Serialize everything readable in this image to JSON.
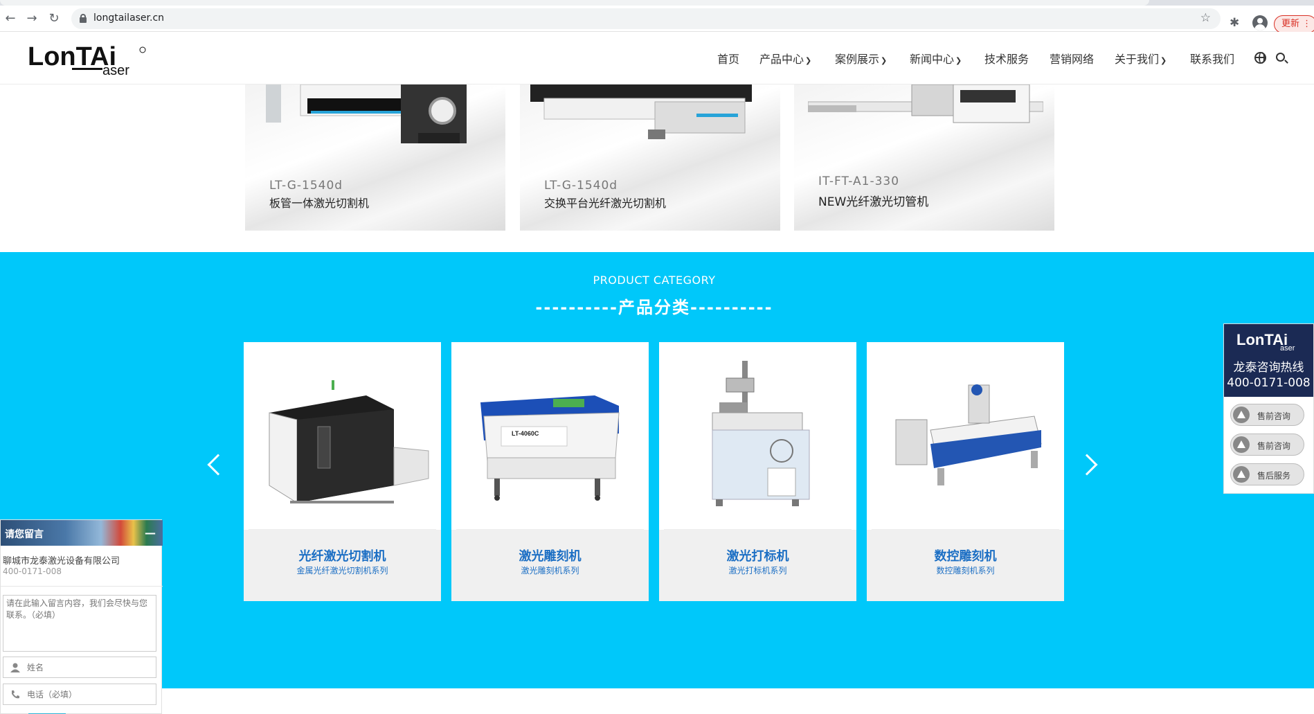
{
  "browser": {
    "url": "longtailaser.cn",
    "update_label": "更新"
  },
  "header": {
    "logo_text": "LonTAi",
    "logo_sub": "aser",
    "nav": [
      {
        "label": "首页",
        "has_dropdown": false
      },
      {
        "label": "产品中心",
        "has_dropdown": true
      },
      {
        "label": "案例展示",
        "has_dropdown": true
      },
      {
        "label": "新闻中心",
        "has_dropdown": true
      },
      {
        "label": "技术服务",
        "has_dropdown": false
      },
      {
        "label": "营销网络",
        "has_dropdown": false
      },
      {
        "label": "关于我们",
        "has_dropdown": true
      },
      {
        "label": "联系我们",
        "has_dropdown": false
      }
    ]
  },
  "banners": [
    {
      "model": "LT-G-1540d",
      "name": "板管一体激光切割机"
    },
    {
      "model": "LT-G-1540d",
      "name": "交换平台光纤激光切割机"
    },
    {
      "model": "IT-FT-A1-330",
      "name": "NEW光纤激光切管机"
    }
  ],
  "category": {
    "title_en": "PRODUCT CATEGORY",
    "title_cn": "----------产品分类----------",
    "bg_color": "#00c8fa",
    "cards": [
      {
        "title": "光纤激光切割机",
        "subtitle": "金属光纤激光切割机系列",
        "icon": "fiber-laser-cutter"
      },
      {
        "title": "激光雕刻机",
        "subtitle": "激光雕刻机系列",
        "icon": "laser-engraver",
        "machine_label": "LT-4060C"
      },
      {
        "title": "激光打标机",
        "subtitle": "激光打标机系列",
        "icon": "laser-marker"
      },
      {
        "title": "数控雕刻机",
        "subtitle": "数控雕刻机系列",
        "icon": "cnc-router"
      }
    ]
  },
  "side_panel": {
    "hotline_label": "龙泰咨询热线",
    "hotline_number": "400-0171-008",
    "buttons": [
      "售前咨询",
      "售前咨询",
      "售后服务"
    ]
  },
  "message_widget": {
    "header": "请您留言",
    "company": "聊城市龙泰激光设备有限公司",
    "phone": "400-0171-008",
    "textarea_placeholder": "请在此输入留言内容，我们会尽快与您联系。（必填）",
    "name_placeholder": "姓名",
    "phone_placeholder": "电话（必填）"
  }
}
